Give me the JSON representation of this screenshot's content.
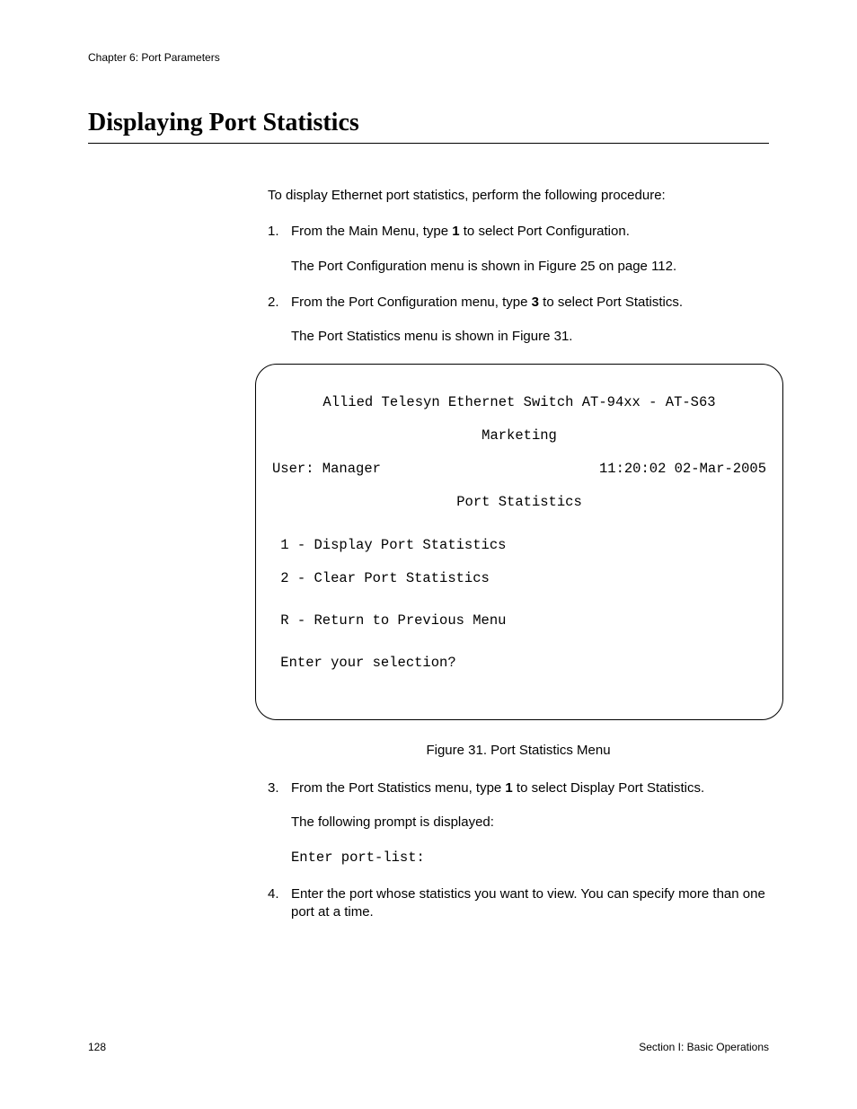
{
  "header": {
    "chapter": "Chapter 6: Port Parameters"
  },
  "title": "Displaying Port Statistics",
  "intro": "To display Ethernet port statistics, perform the following procedure:",
  "steps": {
    "s1": {
      "marker": "1.",
      "pre": "From the Main Menu, type ",
      "bold": "1",
      "post": " to select Port Configuration.",
      "sub": "The Port Configuration menu is shown in Figure 25 on page 112."
    },
    "s2": {
      "marker": "2.",
      "pre": "From the Port Configuration menu, type ",
      "bold": "3",
      "post": " to select Port Statistics.",
      "sub": "The Port Statistics menu is shown in Figure 31."
    },
    "s3": {
      "marker": "3.",
      "pre": "From the Port Statistics menu, type ",
      "bold": "1",
      "post": " to select Display Port Statistics.",
      "sub": "The following prompt is displayed:",
      "prompt": "Enter port-list:"
    },
    "s4": {
      "marker": "4.",
      "text": "Enter the port whose statistics you want to view. You can specify more than one port at a time."
    }
  },
  "terminal": {
    "line1": "Allied Telesyn Ethernet Switch AT-94xx - AT-S63",
    "line2": "Marketing",
    "userLabel": "User: Manager",
    "timestamp": "11:20:02 02-Mar-2005",
    "menuTitle": "Port Statistics",
    "opt1": " 1 - Display Port Statistics",
    "opt2": " 2 - Clear Port Statistics",
    "optR": " R - Return to Previous Menu",
    "prompt": " Enter your selection?"
  },
  "figureCaption": "Figure 31. Port Statistics Menu",
  "footer": {
    "pageNum": "128",
    "section": "Section I: Basic Operations"
  }
}
